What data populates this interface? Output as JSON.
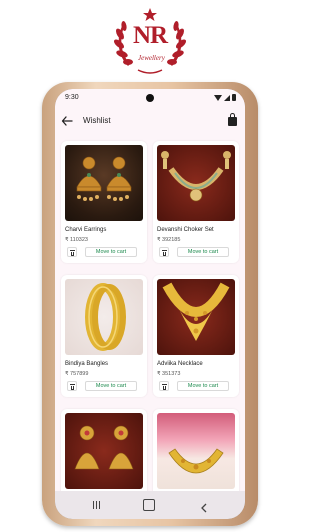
{
  "brand": {
    "monogram": "NR",
    "subtitle": "Jewellery",
    "color": "#b01e2a"
  },
  "status_bar": {
    "time": "9:30"
  },
  "app_bar": {
    "title": "Wishlist",
    "back_icon": "arrow-left-icon",
    "bag_icon": "shopping-bag-icon"
  },
  "products": [
    {
      "name": "Charvi Earrings",
      "price": "₹ 110323",
      "image": "gold jhumka earrings",
      "delete_icon": "trash-icon",
      "action": "Move to cart"
    },
    {
      "name": "Devanshi Choker Set",
      "price": "₹ 392185",
      "image": "kundan choker necklace set",
      "delete_icon": "trash-icon",
      "action": "Move to cart"
    },
    {
      "name": "Bindiya Bangles",
      "price": "₹ 757899",
      "image": "gold bangles",
      "delete_icon": "trash-icon",
      "action": "Move to cart"
    },
    {
      "name": "Adviika Necklace",
      "price": "₹ 351373",
      "image": "gold necklace",
      "delete_icon": "trash-icon",
      "action": "Move to cart"
    },
    {
      "name": "",
      "price": "",
      "image": "gold temple earrings",
      "delete_icon": "trash-icon",
      "action": ""
    },
    {
      "name": "",
      "price": "",
      "image": "gold choker necklace",
      "delete_icon": "trash-icon",
      "action": ""
    }
  ],
  "nav_bar": {
    "recent_icon": "recent-apps-icon",
    "home_icon": "home-icon",
    "back_icon": "back-chevron-icon"
  },
  "colors": {
    "screen_bg": "#fdf5f9",
    "action_text": "#1d8a4e",
    "frame_gold": "#e7c4a3"
  }
}
